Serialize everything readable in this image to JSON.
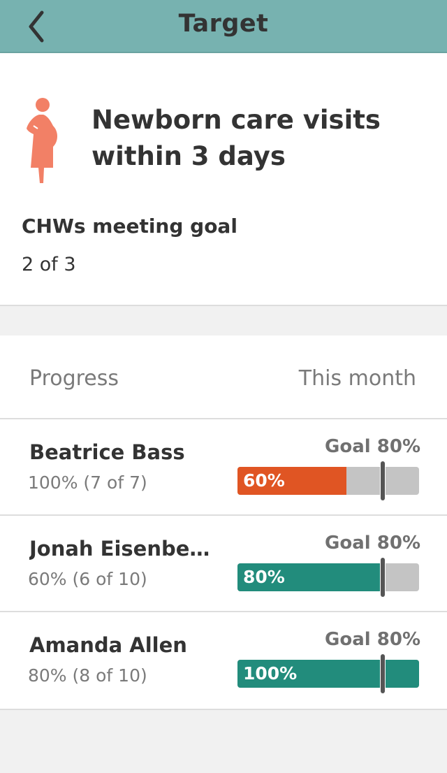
{
  "header": {
    "title": "Target",
    "back_icon": "chevron-left-icon"
  },
  "target": {
    "icon": "pregnant-woman-icon",
    "title": "Newborn care visits within 3 days",
    "goal_label": "CHWs meeting goal",
    "goal_value": "2 of 3"
  },
  "list": {
    "progress_label": "Progress",
    "period_label": "This month",
    "rows": [
      {
        "name": "Beatrice Bass",
        "summary": "100% (7 of 7)",
        "goal": "Goal 80%",
        "bar_label": "60%",
        "progress": 60,
        "goal_percent": 80,
        "color": "#e05523"
      },
      {
        "name": "Jonah Eisenbe…",
        "summary": "60% (6 of 10)",
        "goal": "Goal 80%",
        "bar_label": "80%",
        "progress": 80,
        "goal_percent": 80,
        "color": "#228c7c"
      },
      {
        "name": "Amanda Allen",
        "summary": "80% (8 of 10)",
        "goal": "Goal 80%",
        "bar_label": "100%",
        "progress": 100,
        "goal_percent": 80,
        "color": "#228c7c"
      }
    ]
  },
  "colors": {
    "header_bg": "#77b2b0",
    "icon": "#f28066",
    "below_goal": "#e05523",
    "at_goal": "#228c7c",
    "bar_track": "#c4c4c4"
  }
}
